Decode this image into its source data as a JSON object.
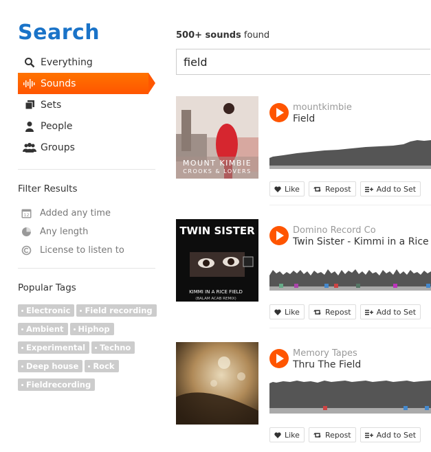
{
  "sidebar": {
    "title": "Search",
    "nav": [
      {
        "label": "Everything",
        "icon": "search-icon"
      },
      {
        "label": "Sounds",
        "icon": "waveform-icon",
        "active": true
      },
      {
        "label": "Sets",
        "icon": "sets-icon"
      },
      {
        "label": "People",
        "icon": "person-icon"
      },
      {
        "label": "Groups",
        "icon": "group-icon"
      }
    ],
    "filter_title": "Filter Results",
    "filters": [
      {
        "label": "Added any time",
        "icon": "calendar-icon"
      },
      {
        "label": "Any length",
        "icon": "clock-icon"
      },
      {
        "label": "License to listen to",
        "icon": "copyright-icon"
      }
    ],
    "calendar_day": "12",
    "tags_title": "Popular Tags",
    "tags": [
      "Electronic",
      "Field recording",
      "Ambient",
      "Hiphop",
      "Experimental",
      "Techno",
      "Deep house",
      "Rock",
      "Fieldrecording"
    ]
  },
  "main": {
    "count_bold": "500+ sounds",
    "count_rest": " found",
    "query": "field",
    "results": [
      {
        "user": "mountkimbie",
        "title": "Field",
        "art_line1": "MOUNT KIMBIE",
        "art_line2": "CROOKS & LOVERS"
      },
      {
        "user": "Domino Record Co",
        "title": "Twin Sister - Kimmi in a Rice Field",
        "art_line1": "TWIN SISTER",
        "art_line2": "KIMMI IN A RICE FIELD",
        "art_line3": "(BALAM ACAB REMIX)"
      },
      {
        "user": "Memory Tapes",
        "title": "Thru The Field"
      }
    ],
    "actions": {
      "like": "Like",
      "repost": "Repost",
      "add": "Add to Set"
    }
  },
  "colors": {
    "accent": "#ff5500",
    "title": "#1a73c8",
    "tag": "#cccccc"
  }
}
